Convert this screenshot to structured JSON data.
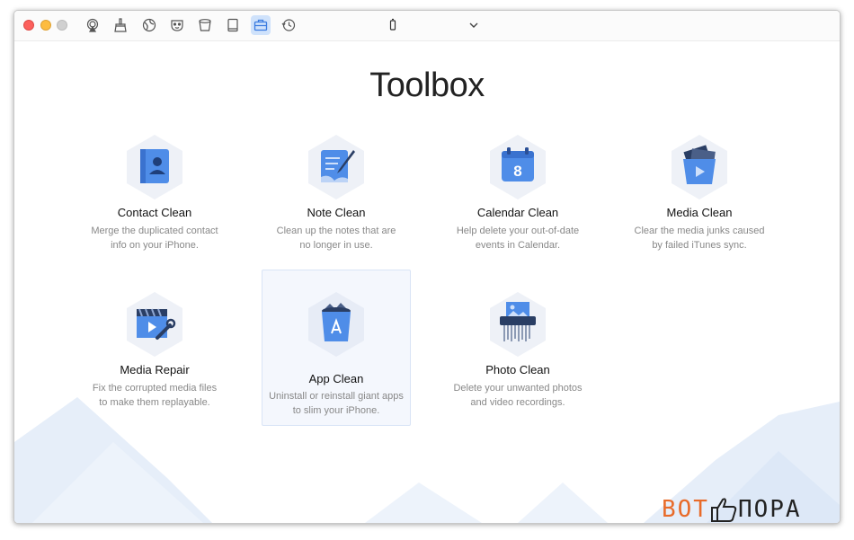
{
  "toolbar": {
    "icons": [
      "airplay-icon",
      "broom-icon",
      "globe-icon",
      "mask-icon",
      "trash-icon",
      "book-icon",
      "toolbox-icon",
      "clock-icon"
    ],
    "active": "toolbox-icon",
    "device_icon": "phone-icon",
    "dropdown_icon": "chevron-down-icon"
  },
  "page": {
    "title": "Toolbox"
  },
  "tools": [
    {
      "name": "Contact Clean",
      "desc": [
        "Merge the duplicated contact",
        "info on your iPhone."
      ],
      "icon": "contact-book-icon"
    },
    {
      "name": "Note Clean",
      "desc": [
        "Clean up the notes that are",
        "no longer in use."
      ],
      "icon": "note-pen-icon"
    },
    {
      "name": "Calendar Clean",
      "desc": [
        "Help delete your out-of-date",
        "events in Calendar."
      ],
      "icon": "calendar-icon",
      "calendar_day": "8"
    },
    {
      "name": "Media Clean",
      "desc": [
        "Clear the media junks caused",
        "by failed iTunes sync."
      ],
      "icon": "media-bin-icon"
    },
    {
      "name": "Media Repair",
      "desc": [
        "Fix the corrupted media files",
        "to make them replayable."
      ],
      "icon": "video-wrench-icon"
    },
    {
      "name": "App Clean",
      "desc": [
        "Uninstall or reinstall giant apps",
        "to slim your iPhone."
      ],
      "icon": "app-bin-icon"
    },
    {
      "name": "Photo Clean",
      "desc": [
        "Delete your unwanted photos",
        "and video recordings."
      ],
      "icon": "photo-shredder-icon"
    }
  ],
  "colors": {
    "accent": "#4f8de8",
    "hex_bg": "#eef1f7",
    "selected_bg": "#f4f7fd"
  },
  "watermark": {
    "part1": "BOT",
    "part2": "ПОРА"
  }
}
